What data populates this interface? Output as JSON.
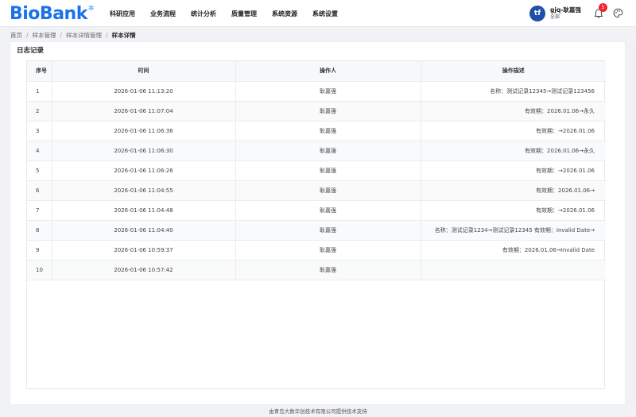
{
  "app": {
    "logo_text": "BioBank",
    "nav": [
      "科研应用",
      "业务流程",
      "统计分析",
      "质量管理",
      "系统资源",
      "系统设置"
    ]
  },
  "user": {
    "avatar_letter": "tf",
    "name": "gjq-耿嘉强",
    "org": "全部",
    "notifications": "5"
  },
  "breadcrumb": [
    "首页",
    "样本管理",
    "样本详情管理",
    "样本详情"
  ],
  "section": {
    "title": "日志记录"
  },
  "table": {
    "headers": [
      "序号",
      "时间",
      "操作人",
      "操作描述"
    ],
    "rows": [
      [
        "1",
        "2026-01-06 11:13:20",
        "耿嘉强",
        "名称：测试记录12345→测试记录123456"
      ],
      [
        "2",
        "2026-01-06 11:07:04",
        "耿嘉强",
        "有效期：2026.01.06→永久"
      ],
      [
        "3",
        "2026-01-06 11:06:36",
        "耿嘉强",
        "有效期：→2026.01.06"
      ],
      [
        "4",
        "2026-01-06 11:06:30",
        "耿嘉强",
        "有效期：2026.01.06→永久"
      ],
      [
        "5",
        "2026-01-06 11:06:26",
        "耿嘉强",
        "有效期：→2026.01.06"
      ],
      [
        "6",
        "2026-01-06 11:04:55",
        "耿嘉强",
        "有效期：2026.01.06→"
      ],
      [
        "7",
        "2026-01-06 11:04:48",
        "耿嘉强",
        "有效期：→2026.01.06"
      ],
      [
        "8",
        "2026-01-06 11:04:40",
        "耿嘉强",
        "名称：测试记录1234→测试记录12345 有效期：Invalid Date→"
      ],
      [
        "9",
        "2026-01-06 10:59:37",
        "耿嘉强",
        "有效期：2026.01.06→Invalid Date"
      ],
      [
        "10",
        "2026-01-06 10:57:42",
        "耿嘉强",
        ""
      ]
    ]
  },
  "footer": {
    "text": "由青岛大数华创技术有限公司提供技术支持"
  },
  "colors": {
    "brand": "#1a73e8",
    "badge": "#f5222d",
    "header_bg": "#ffffff"
  }
}
